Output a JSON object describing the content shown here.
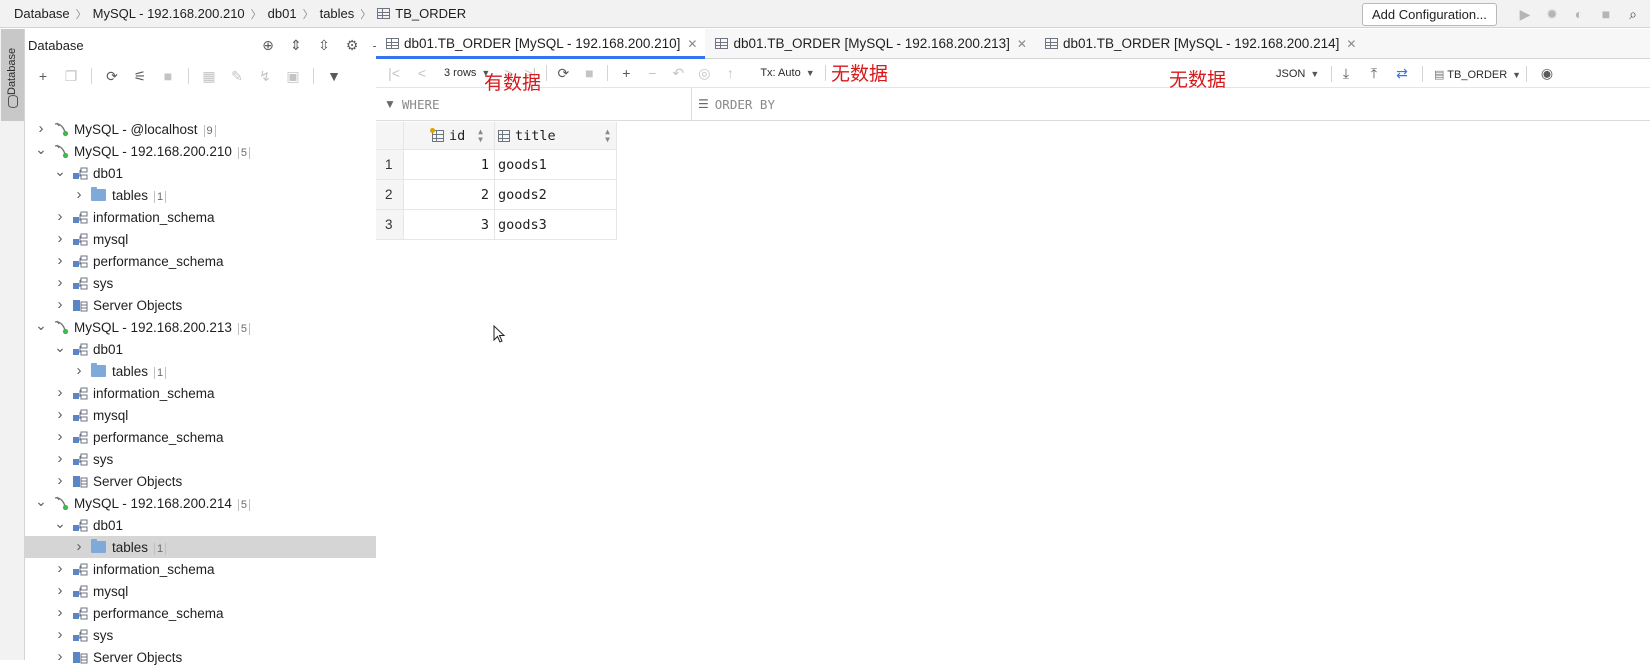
{
  "breadcrumb": {
    "items": [
      "Database",
      "MySQL - 192.168.200.210",
      "db01",
      "tables"
    ],
    "current": "TB_ORDER"
  },
  "top_toolbar": {
    "add_config_label": "Add Configuration..."
  },
  "left_strip": {
    "db_tab_label": "Database"
  },
  "db_panel": {
    "title": "Database",
    "tree": [
      {
        "level": 0,
        "kind": "connection",
        "label": "MySQL - @localhost",
        "badge": "9",
        "expanded": false
      },
      {
        "level": 0,
        "kind": "connection",
        "label": "MySQL - 192.168.200.210",
        "badge": "5",
        "expanded": true
      },
      {
        "level": 1,
        "kind": "schema",
        "label": "db01",
        "badge": "",
        "expanded": true
      },
      {
        "level": 2,
        "kind": "folder",
        "label": "tables",
        "badge": "1",
        "expanded": false
      },
      {
        "level": 1,
        "kind": "schema",
        "label": "information_schema",
        "badge": "",
        "expanded": false
      },
      {
        "level": 1,
        "kind": "schema",
        "label": "mysql",
        "badge": "",
        "expanded": false
      },
      {
        "level": 1,
        "kind": "schema",
        "label": "performance_schema",
        "badge": "",
        "expanded": false
      },
      {
        "level": 1,
        "kind": "schema",
        "label": "sys",
        "badge": "",
        "expanded": false
      },
      {
        "level": 1,
        "kind": "server-objects",
        "label": "Server Objects",
        "badge": "",
        "expanded": false
      },
      {
        "level": 0,
        "kind": "connection",
        "label": "MySQL - 192.168.200.213",
        "badge": "5",
        "expanded": true
      },
      {
        "level": 1,
        "kind": "schema",
        "label": "db01",
        "badge": "",
        "expanded": true
      },
      {
        "level": 2,
        "kind": "folder",
        "label": "tables",
        "badge": "1",
        "expanded": false
      },
      {
        "level": 1,
        "kind": "schema",
        "label": "information_schema",
        "badge": "",
        "expanded": false
      },
      {
        "level": 1,
        "kind": "schema",
        "label": "mysql",
        "badge": "",
        "expanded": false
      },
      {
        "level": 1,
        "kind": "schema",
        "label": "performance_schema",
        "badge": "",
        "expanded": false
      },
      {
        "level": 1,
        "kind": "schema",
        "label": "sys",
        "badge": "",
        "expanded": false
      },
      {
        "level": 1,
        "kind": "server-objects",
        "label": "Server Objects",
        "badge": "",
        "expanded": false
      },
      {
        "level": 0,
        "kind": "connection",
        "label": "MySQL - 192.168.200.214",
        "badge": "5",
        "expanded": true
      },
      {
        "level": 1,
        "kind": "schema",
        "label": "db01",
        "badge": "",
        "expanded": true
      },
      {
        "level": 2,
        "kind": "folder",
        "label": "tables",
        "badge": "1",
        "expanded": false,
        "selected": true
      },
      {
        "level": 1,
        "kind": "schema",
        "label": "information_schema",
        "badge": "",
        "expanded": false
      },
      {
        "level": 1,
        "kind": "schema",
        "label": "mysql",
        "badge": "",
        "expanded": false
      },
      {
        "level": 1,
        "kind": "schema",
        "label": "performance_schema",
        "badge": "",
        "expanded": false
      },
      {
        "level": 1,
        "kind": "schema",
        "label": "sys",
        "badge": "",
        "expanded": false
      },
      {
        "level": 1,
        "kind": "server-objects",
        "label": "Server Objects",
        "badge": "",
        "expanded": false
      }
    ]
  },
  "editor": {
    "tabs": [
      {
        "label": "db01.TB_ORDER [MySQL - 192.168.200.210]",
        "active": true
      },
      {
        "label": "db01.TB_ORDER [MySQL - 192.168.200.213]",
        "active": false
      },
      {
        "label": "db01.TB_ORDER [MySQL - 192.168.200.214]",
        "active": false
      }
    ],
    "toolbar": {
      "rows_label": "3 rows",
      "tx_label": "Tx: Auto",
      "format_label": "JSON",
      "table_label": "TB_ORDER"
    },
    "filter": {
      "where_label": "WHERE",
      "orderby_label": "ORDER BY"
    },
    "grid": {
      "columns": [
        "id",
        "title"
      ],
      "rows": [
        {
          "num": "1",
          "id": "1",
          "title": "goods1"
        },
        {
          "num": "2",
          "id": "2",
          "title": "goods2"
        },
        {
          "num": "3",
          "id": "3",
          "title": "goods3"
        }
      ]
    }
  },
  "annotations": {
    "has_data": "有数据",
    "no_data_1": "无数据",
    "no_data_2": "无数据",
    "color": "#d7191c"
  },
  "colors": {
    "accent": "#3574f0",
    "selected_row": "#d5d5d5",
    "connection_dot": "#3dbb4a"
  }
}
